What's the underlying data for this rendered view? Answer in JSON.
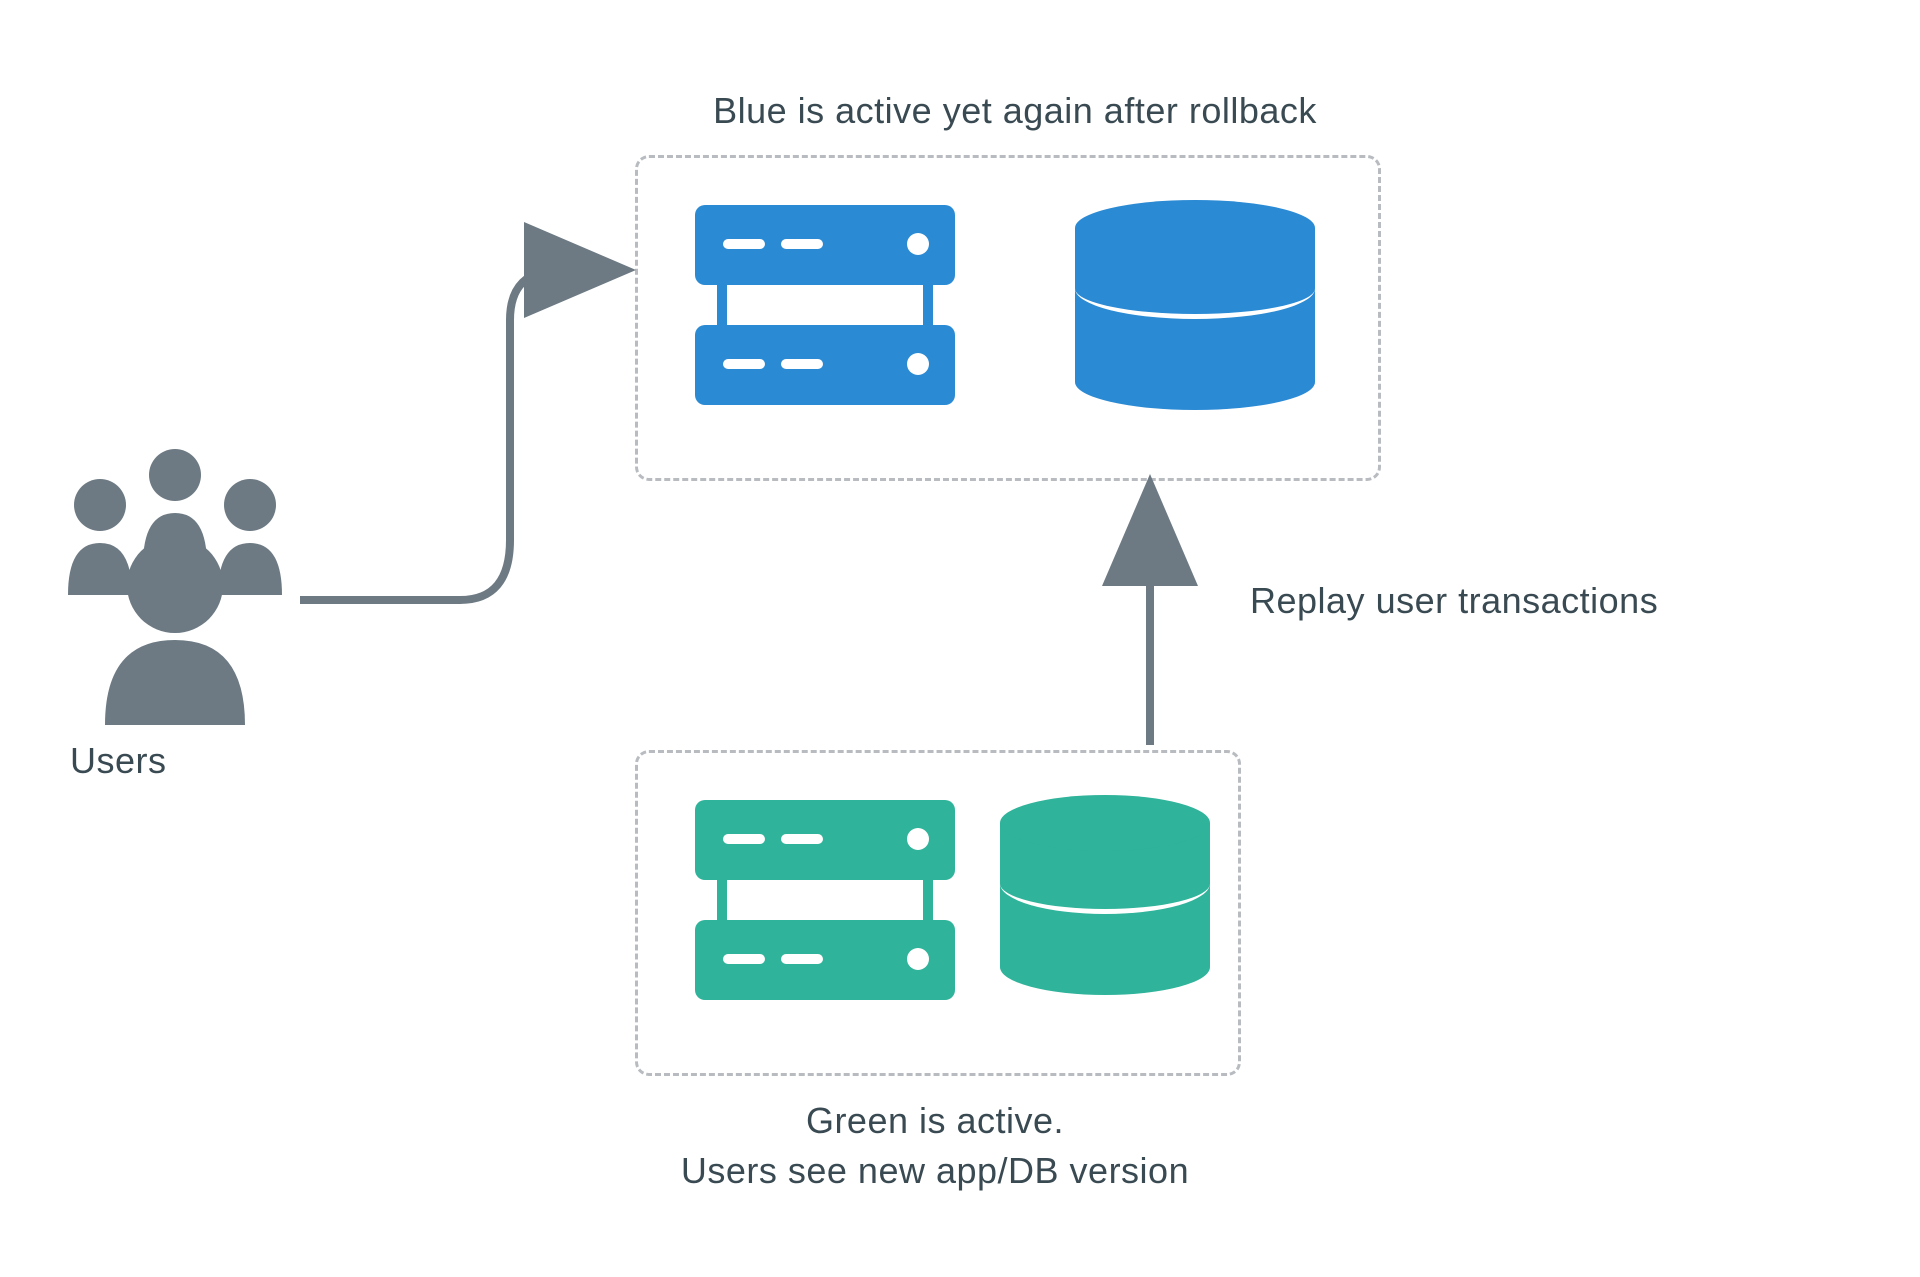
{
  "labels": {
    "users": "Users",
    "blue_title": "Blue is active yet again after rollback",
    "green_title_line1": "Green is active.",
    "green_title_line2": "Users see new app/DB version",
    "replay": "Replay user transactions"
  },
  "colors": {
    "blue": "#2a8ad4",
    "green": "#2fb39a",
    "grey": "#6d7a83",
    "border": "#b8bcc0",
    "text": "#3a4a52"
  },
  "environments": {
    "blue": {
      "servers": 2,
      "db": 1
    },
    "green": {
      "servers": 2,
      "db": 1
    }
  }
}
